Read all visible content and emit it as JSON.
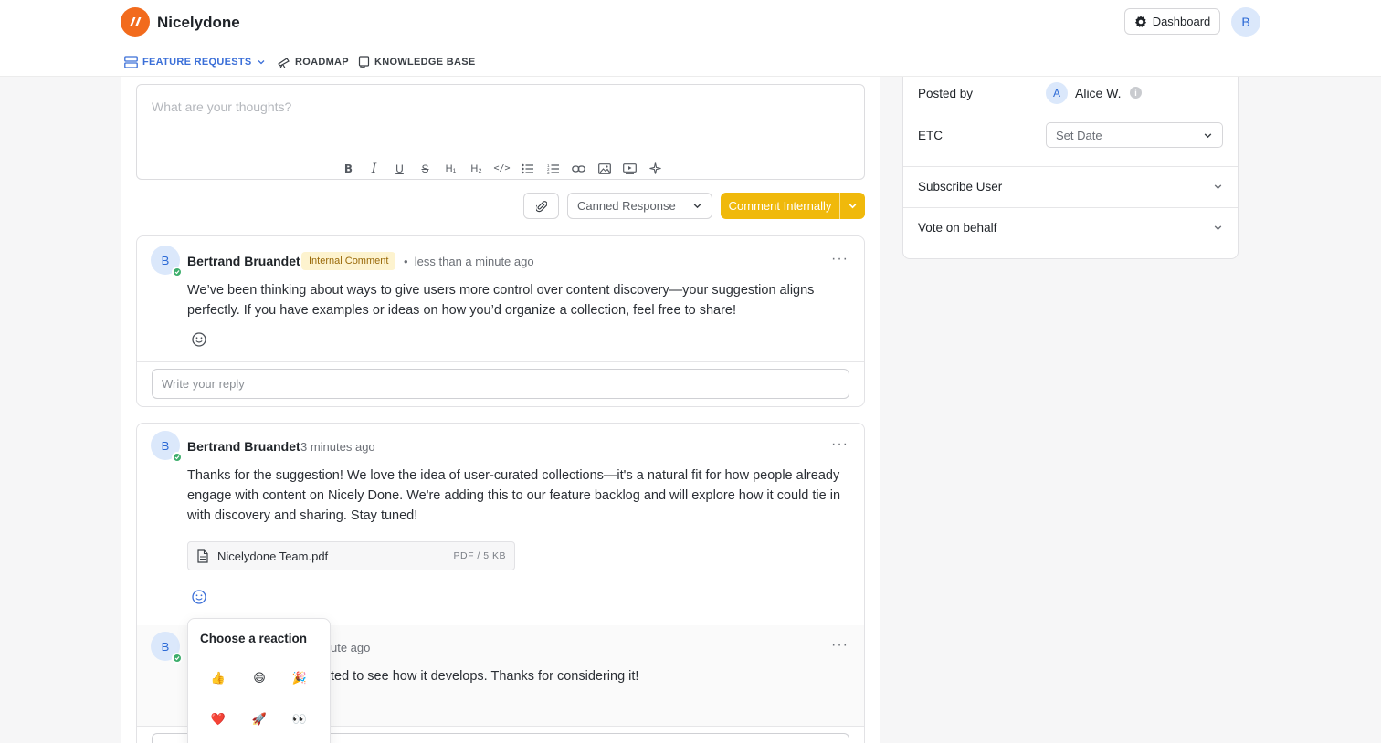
{
  "app": {
    "brand": "Nicelydone",
    "dashboard_label": "Dashboard",
    "user_initial": "B"
  },
  "nav": {
    "feature_requests": "FEATURE REQUESTS",
    "roadmap": "ROADMAP",
    "knowledge_base": "KNOWLEDGE BASE"
  },
  "editor": {
    "placeholder": "What are your thoughts?",
    "toolbar": [
      "bold-icon",
      "italic-icon",
      "underline-icon",
      "strikethrough-icon",
      "heading1-icon",
      "heading2-icon",
      "code-icon",
      "bullet-list-icon",
      "ordered-list-icon",
      "link-icon",
      "image-icon",
      "video-icon",
      "magic-icon"
    ],
    "canned_response": "Canned Response",
    "comment_button": "Comment Internally"
  },
  "comments": [
    {
      "initial": "B",
      "author": "Bertrand Bruandet",
      "badge": "Internal Comment",
      "time": "less than a minute ago",
      "text": "We’ve been thinking about ways to give users more control over content discovery—your suggestion aligns perfectly. If you have examples or ideas on how you’d organize a collection, feel free to share!",
      "reply_placeholder": "Write your reply"
    },
    {
      "initial": "B",
      "author": "Bertrand Bruandet",
      "time": "3 minutes ago",
      "text": "Thanks for the suggestion! We love the idea of user-curated collections—it's a natural fit for how people already engage with content on Nicely Done. We're adding this to our feature backlog and will explore how it could tie in with discovery and sharing. Stay tuned!",
      "attachment": {
        "name": "Nicelydone Team.pdf",
        "size": "PDF / 5 KB"
      }
    }
  ],
  "nested_reply": {
    "initial": "B",
    "time_fragment": "ute ago",
    "text_fragment": "ted to see how it develops. Thanks for considering it!"
  },
  "reaction_picker": {
    "title": "Choose a reaction",
    "reactions": [
      "👍",
      "😄",
      "🎉",
      "❤️",
      "🚀",
      "👀"
    ]
  },
  "sidebar": {
    "posted_by_label": "Posted by",
    "posted_by_initial": "A",
    "posted_by_name": "Alice W.",
    "etc_label": "ETC",
    "etc_value": "Set Date",
    "subscribe_label": "Subscribe User",
    "vote_label": "Vote on behalf"
  },
  "colors": {
    "brand": "#f26b1d",
    "accent_button": "#f0b90b",
    "nav_active": "#3b6fd8",
    "verified": "#3dae6c"
  }
}
